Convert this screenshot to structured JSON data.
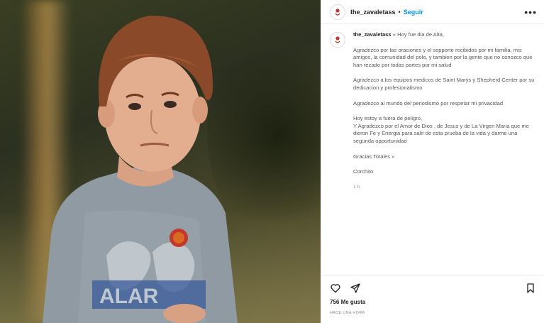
{
  "post": {
    "username": "the_zavaletass",
    "separator": "•",
    "follow_label": "Seguir",
    "more_label": "•••",
    "image_alt": "Foto de un niño con camiseta gris",
    "caption": {
      "username": "the_zavaletass",
      "lines": [
        "Hoy fue dia de Alta,",
        "Agradezco por las oraciones y el sopporte recibidos por mi familia, mis amigos, la comunidad del polo, y tambien por la gente que no conozco que han rezado por todas partes por mi salud",
        "Agradezco a los equipos medicos de Saint Marys y Shepherd Center por su dedicacion y profesionalismo",
        "Agradezco al mundo del periodismo por respetar mi privacidad",
        "Hoy estoy a fuera de peligro,",
        "Y Agradezco por el Amor de Dios , de Jesus y de La Virgen Maria que me dieron Fe y Energia para salir de esta prueba de la vida y darme una segunda opportunidad",
        "Gracias Totales »",
        "Corchito"
      ],
      "first_prefix": "«",
      "time": "1 h"
    },
    "likes": "756 Me gusta",
    "posted_ago": "HACE UNA HORA"
  },
  "icons": {
    "like": "heart-icon",
    "share": "paper-plane-icon",
    "save": "bookmark-icon",
    "avatar": "polo-logo-icon"
  },
  "colors": {
    "follow": "#0095f6",
    "text": "#262626",
    "muted": "#8e8e8e"
  }
}
